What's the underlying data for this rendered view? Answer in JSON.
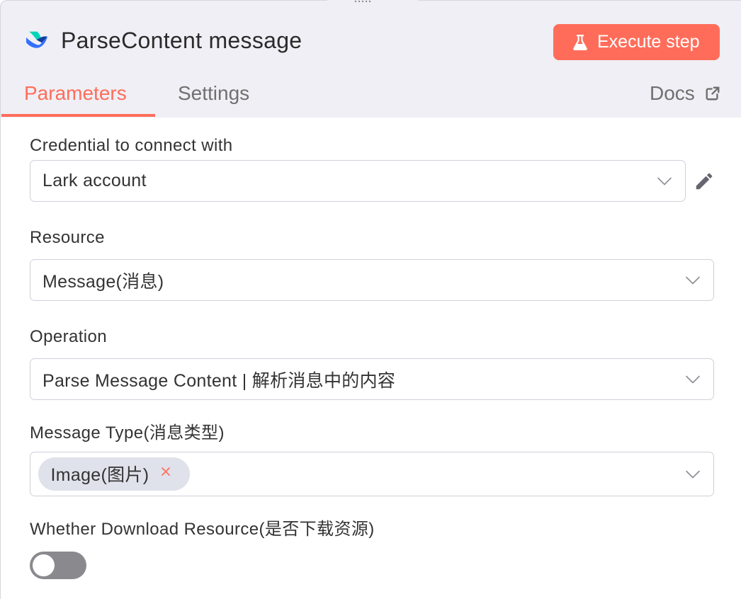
{
  "theme": {
    "accent": "#ff6d5a",
    "header_bg": "#efeff5",
    "border": "#d5d5dd",
    "text": "#333333",
    "muted": "#707070",
    "chip_bg": "#dfe2ea",
    "toggle_off": "#8a8a8e"
  },
  "drag_handle": {
    "icon": "drag-dots-icon"
  },
  "header": {
    "logo_icon": "lark-logo-icon",
    "title": "ParseContent message",
    "execute_button": {
      "label": "Execute step",
      "icon": "flask-icon"
    }
  },
  "tabs": [
    {
      "label": "Parameters",
      "active": true
    },
    {
      "label": "Settings",
      "active": false
    }
  ],
  "docs_link": {
    "label": "Docs",
    "icon": "external-link-icon"
  },
  "fields": {
    "credential": {
      "label": "Credential to connect with",
      "value": "Lark account",
      "edit_icon": "pencil-icon",
      "dropdown_icon": "chevron-down-icon"
    },
    "resource": {
      "label": "Resource",
      "value": "Message(消息)",
      "dropdown_icon": "chevron-down-icon"
    },
    "operation": {
      "label": "Operation",
      "value": "Parse Message Content | 解析消息中的内容",
      "dropdown_icon": "chevron-down-icon"
    },
    "message_type": {
      "label": "Message Type(消息类型)",
      "selected": [
        "Image(图片)"
      ],
      "remove_icon": "close-icon",
      "dropdown_icon": "chevron-down-icon"
    },
    "download_resource": {
      "label": "Whether Download Resource(是否下载资源)",
      "enabled": false
    }
  }
}
